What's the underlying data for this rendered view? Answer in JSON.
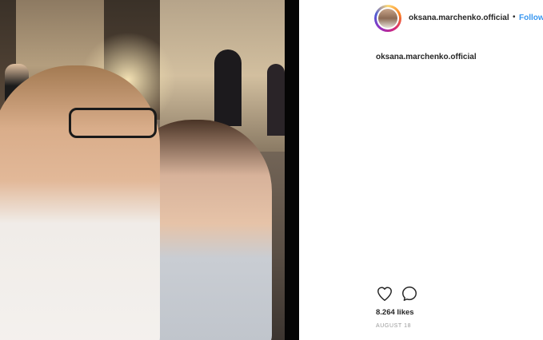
{
  "post": {
    "photo_alt": "",
    "author": {
      "username": "oksana.marchenko.official",
      "separator": "•",
      "follow_label": "Follow"
    },
    "caption": {
      "username": "oksana.marchenko.official"
    },
    "actions": {
      "like_icon": "heart-icon",
      "comment_icon": "comment-icon"
    },
    "likes_text": "8.264 likes",
    "date_text": "AUGUST 18"
  },
  "colors": {
    "link_blue": "#3897f0",
    "text_dark": "#262626",
    "text_muted": "#999999"
  }
}
